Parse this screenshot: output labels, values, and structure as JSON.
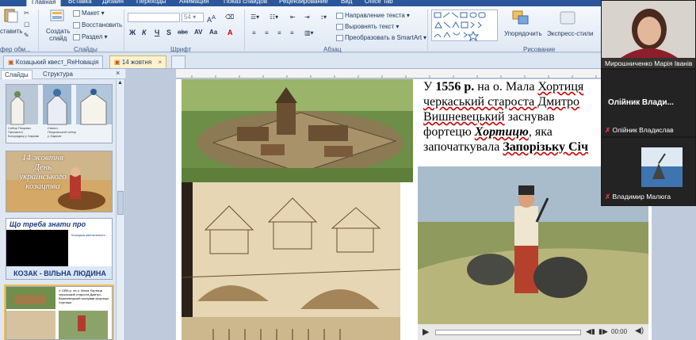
{
  "ribbon_tabs": [
    "Главная",
    "Вставка",
    "Дизайн",
    "Переходы",
    "Анимация",
    "Показ слайдов",
    "Рецензирование",
    "Вид",
    "Office Tab"
  ],
  "ribbon": {
    "paste_label": "ставить",
    "clipboard_label": "фер обм...",
    "create_slide": [
      "Создать",
      "слайд"
    ],
    "layout": "Макет",
    "reset": "Восстановить",
    "section": "Раздел",
    "slides_label": "Слайды",
    "font_label": "Шрифт",
    "font_size": "54",
    "format_buttons": [
      "Ж",
      "К",
      "Ч",
      "S",
      "abc",
      "AV",
      "Aa",
      "A"
    ],
    "text_direction": "Направление текста",
    "align_text": "Выровнять текст",
    "smartart": "Преобразовать в SmartArt",
    "paragraph_label": "Абзац",
    "arrange": "Упорядочить",
    "quick_styles": "Экспресс-стили",
    "drawing_label": "Рисование"
  },
  "doc_tabs": [
    "Козацький квест_ReНовація",
    "14 жовтня"
  ],
  "pane_tabs": [
    "Слайды",
    "Структура"
  ],
  "thumbnails": [
    {
      "num": "",
      "caption_left": "Собор Покрови Пресвятої Богородиці у Харкові",
      "caption_right": "Свято-Покровський собор у Харкові"
    },
    {
      "num": "",
      "lines": [
        "14 жовтня",
        "День",
        "українського",
        "козацтва"
      ]
    },
    {
      "num": "",
      "title": "Що треба знати про козаків",
      "side": "Козацька ментальність...",
      "footer": "КОЗАК - ВІЛЬНА ЛЮДИНА"
    },
    {
      "num": "",
      "mini_text": "У 1556 р. на о. Мала Хортиця черкаський староста Дмитро Вишневецький заснував фортецю Хортицю"
    }
  ],
  "slide": {
    "lines": [
      [
        {
          "t": "У ",
          "b": false
        },
        {
          "t": "1556 р.",
          "b": true
        },
        {
          "t": " на о. Мала ",
          "b": false
        },
        {
          "t": "Хортиця",
          "b": false,
          "u": true
        }
      ],
      [
        {
          "t": "черкаський староста Дмитро",
          "b": false,
          "u": true
        }
      ],
      [
        {
          "t": "Вишневецький",
          "b": false,
          "u": true
        },
        {
          "t": " заснував",
          "b": false
        }
      ],
      [
        {
          "t": "фортецю ",
          "b": false
        },
        {
          "t": "Хортицю",
          "b": true,
          "i": true,
          "u": true
        },
        {
          "t": ", яка",
          "b": false
        }
      ],
      [
        {
          "t": "започаткувала ",
          "b": false
        },
        {
          "t": "Запорізьку Січ",
          "b": true,
          "u": true
        }
      ]
    ],
    "video_time": "00:00"
  },
  "call": {
    "tile1_name": "Мирошниченко Марія Іванів",
    "tile2_big": "Олійник  Влади...",
    "tile2_name": "Олійник Владислав",
    "tile3_name": "Владимир Малюга"
  },
  "colors": {
    "accent": "#2b579a",
    "selected_tab": "#fdf2cf",
    "mic_muted": "#e03a3a"
  }
}
